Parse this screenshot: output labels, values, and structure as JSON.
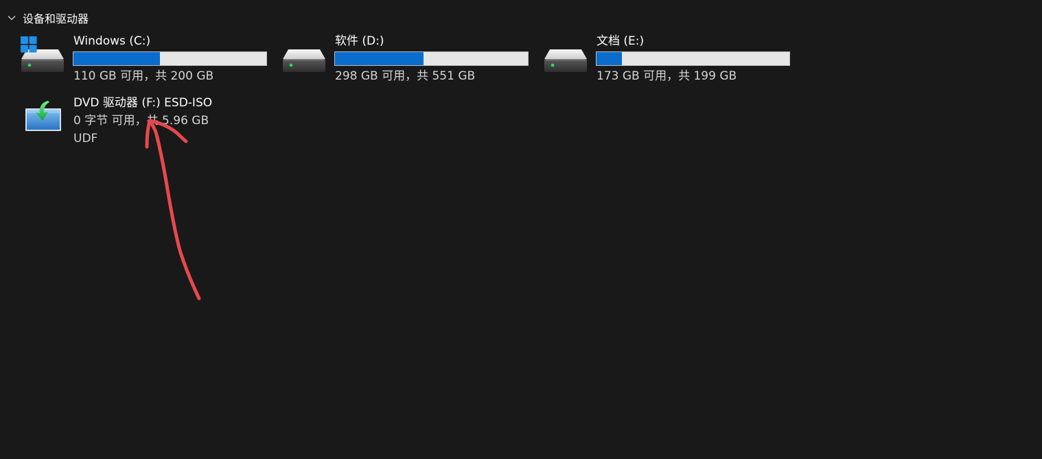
{
  "section": {
    "title": "设备和驱动器",
    "chevron_icon": "chevron-down-icon"
  },
  "drives": [
    {
      "name": "Windows (C:)",
      "free_text": "110 GB 可用，共 200 GB",
      "used_fraction": 0.45,
      "icon": "system-drive-icon"
    },
    {
      "name": "软件 (D:)",
      "free_text": "298 GB 可用，共 551 GB",
      "used_fraction": 0.46,
      "icon": "hard-drive-icon"
    },
    {
      "name": "文档 (E:)",
      "free_text": "173 GB 可用，共 199 GB",
      "used_fraction": 0.13,
      "icon": "hard-drive-icon"
    }
  ],
  "dvd": {
    "name": "DVD 驱动器 (F:) ESD-ISO",
    "free_text": "0 字节 可用，共 5.96 GB",
    "filesystem": "UDF",
    "icon": "dvd-drive-icon"
  },
  "colors": {
    "background": "#191919",
    "bar_fill": "#0a6ccc",
    "bar_track": "#e6e6e6",
    "annotation": "#e8484d"
  },
  "annotation": {
    "icon": "red-arrow-annotation"
  }
}
